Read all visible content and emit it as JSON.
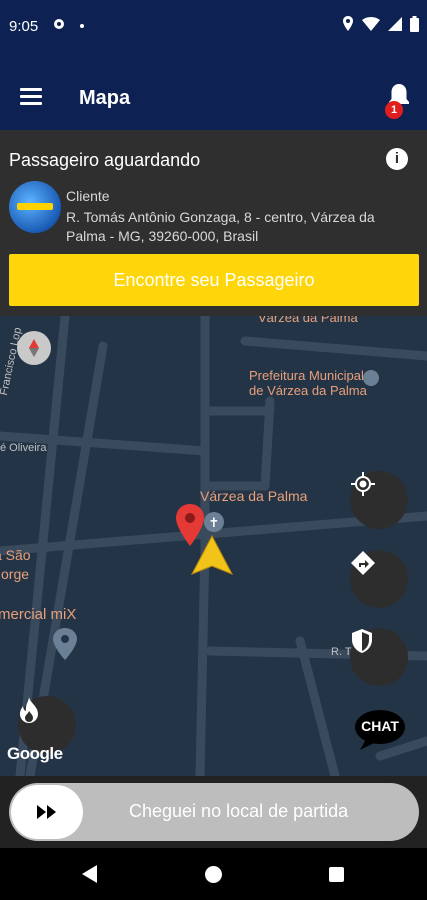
{
  "status_bar": {
    "time": "9:05"
  },
  "app_bar": {
    "title": "Mapa",
    "notification_count": "1"
  },
  "passenger_card": {
    "title": "Passageiro aguardando",
    "client_label": "Cliente",
    "address": "R. Tomás Antônio Gonzaga, 8 - centro, Várzea da Palma - MG, 39260-000, Brasil",
    "find_button": "Encontre seu Passageiro"
  },
  "map": {
    "labels": {
      "top_street": "Várzea da Palma",
      "prefeitura": "Prefeitura Municipal de Várzea da Palma",
      "street_left": "Francisco Lop",
      "oliveira": "é Oliveira",
      "city": "Várzea da Palma",
      "sao_jorge": "a São Jorge",
      "comercial": "mercial miX",
      "rua": "R. T"
    },
    "chat_label": "CHAT",
    "attribution": "Google"
  },
  "bottom": {
    "slider_label": "Cheguei no local de partida"
  },
  "colors": {
    "primary": "#0d2252",
    "accent": "#ffd60a",
    "badge": "#e01e1e"
  }
}
